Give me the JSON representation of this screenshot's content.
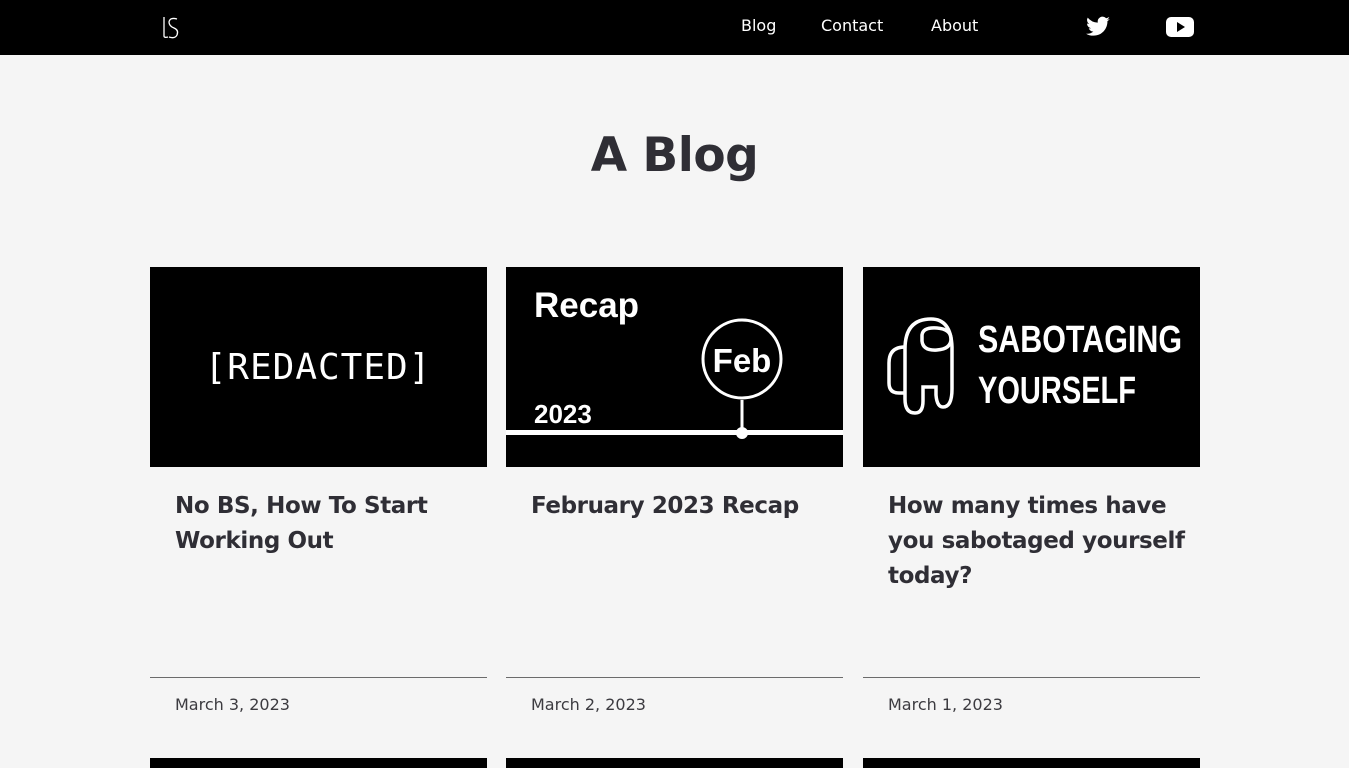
{
  "header": {
    "logo_name": "ls-logo",
    "nav": [
      {
        "label": "Blog"
      },
      {
        "label": "Contact"
      },
      {
        "label": "About"
      }
    ],
    "social": [
      "twitter-icon",
      "youtube-icon"
    ]
  },
  "main": {
    "title": "A Blog",
    "posts": [
      {
        "title": "No BS, How To Start Working Out",
        "date": "March 3, 2023",
        "thumb": {
          "text": "[REDACTED]"
        }
      },
      {
        "title": "February 2023 Recap",
        "date": "March 2, 2023",
        "thumb": {
          "text_recap": "Recap",
          "text_month": "Feb",
          "text_year": "2023"
        }
      },
      {
        "title": "How many times have you sabotaged yourself today?",
        "date": "March 1, 2023",
        "thumb": {
          "line1": "SABOTAGING",
          "line2": "YOURSELF"
        }
      }
    ]
  },
  "colors": {
    "header_bg": "#000000",
    "page_bg": "#f5f5f5",
    "text": "#2f2e35"
  }
}
